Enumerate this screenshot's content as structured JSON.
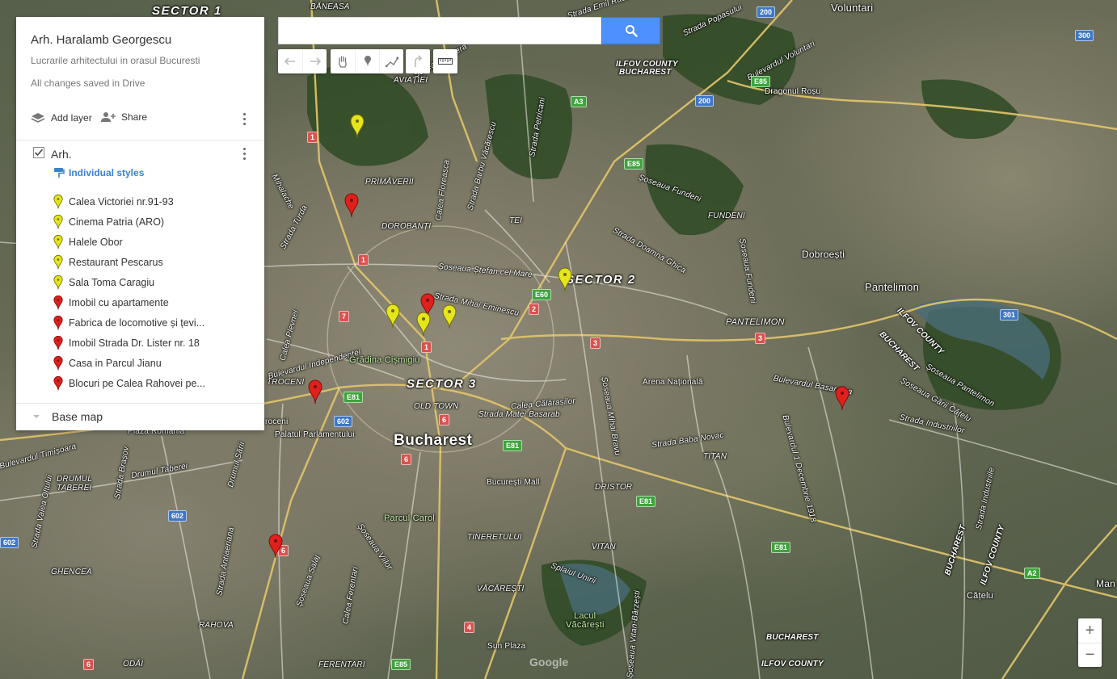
{
  "panel": {
    "title": "Arh. Haralamb Georgescu",
    "description": "Lucrarile arhitectului in orasul Bucuresti",
    "save_status": "All changes saved in Drive",
    "add_layer_label": "Add layer",
    "share_label": "Share",
    "layer": {
      "name": "Arh.",
      "checked": true,
      "styles_label": "Individual styles",
      "features": [
        {
          "label": "Calea Victoriei nr.91-93",
          "color": "#e6e41b"
        },
        {
          "label": "Cinema Patria (ARO)",
          "color": "#e6e41b"
        },
        {
          "label": "Halele Obor",
          "color": "#e6e41b"
        },
        {
          "label": "Restaurant Pescarus",
          "color": "#e6e41b"
        },
        {
          "label": "Sala Toma Caragiu",
          "color": "#e6e41b"
        },
        {
          "label": "Imobil cu apartamente",
          "color": "#e0201c"
        },
        {
          "label": "Fabrica de locomotive și țevi...",
          "color": "#e0201c"
        },
        {
          "label": "Imobil Strada Dr. Lister nr. 18",
          "color": "#e0201c"
        },
        {
          "label": "Casa in Parcul Jianu",
          "color": "#e0201c"
        },
        {
          "label": "Blocuri pe Calea Rahovei pe...",
          "color": "#e0201c"
        }
      ]
    },
    "base_map_label": "Base map"
  },
  "search": {
    "value": "",
    "placeholder": "",
    "button_icon": "search-icon"
  },
  "toolbar": {
    "icons": [
      "undo-icon",
      "redo-icon",
      "hand-icon",
      "marker-icon",
      "draw-line-icon",
      "directions-icon",
      "ruler-icon"
    ]
  },
  "zoom": {
    "in_label": "+",
    "out_label": "−"
  },
  "watermark": "Google",
  "colors": {
    "accent": "#4d90fe",
    "link": "#3b82d4",
    "marker_yellow": "#e6e41b",
    "marker_red": "#e0201c"
  },
  "map": {
    "districts": [
      {
        "key": "sector1",
        "text": "SECTOR 1"
      },
      {
        "key": "sector2",
        "text": "SECTOR 2"
      },
      {
        "key": "sector3",
        "text": "SECTOR 3"
      }
    ],
    "cities": [
      {
        "key": "bucharest",
        "text": "Bucharest"
      }
    ],
    "towns": [
      {
        "key": "voluntari",
        "text": "Voluntari"
      },
      {
        "key": "pantelimon",
        "text": "Pantelimon"
      },
      {
        "key": "dobroesti",
        "text": "Dobroești"
      },
      {
        "key": "catelu",
        "text": "Cățelu"
      },
      {
        "key": "man",
        "text": "Man"
      }
    ],
    "labels": [
      {
        "key": "baneasa",
        "text": "BĂNEASA"
      },
      {
        "key": "aviatiei",
        "text": "AVIAȚIEI"
      },
      {
        "key": "ilfov1",
        "text": "ILFOV COUNTY"
      },
      {
        "key": "bucharest1",
        "text": "BUCHAREST"
      },
      {
        "key": "dragonul",
        "text": "Dragonul Roșu"
      },
      {
        "key": "primaverii",
        "text": "PRIMĂVERII"
      },
      {
        "key": "dorobanti",
        "text": "DOROBANȚI"
      },
      {
        "key": "tei",
        "text": "TEI"
      },
      {
        "key": "fundeni",
        "text": "FUNDENI"
      },
      {
        "key": "pantelimon_d",
        "text": "PANTELIMON"
      },
      {
        "key": "ilfov2",
        "text": "ILFOV COUNTY"
      },
      {
        "key": "bucharest2",
        "text": "BUCHAREST"
      },
      {
        "key": "oldtown",
        "text": "OLD TOWN"
      },
      {
        "key": "drumul_taberei",
        "text": "DRUMUL"
      },
      {
        "key": "taberei",
        "text": "TABEREI"
      },
      {
        "key": "ghencea",
        "text": "GHENCEA"
      },
      {
        "key": "rahova",
        "text": "RAHOVA"
      },
      {
        "key": "ferentari",
        "text": "FERENTARI"
      },
      {
        "key": "odai",
        "text": "ODĂI"
      },
      {
        "key": "tineretului",
        "text": "TINERETULUI"
      },
      {
        "key": "vacaresti",
        "text": "VĂCĂREȘTI"
      },
      {
        "key": "vitan",
        "text": "VITAN"
      },
      {
        "key": "dristor",
        "text": "DRISTOR"
      },
      {
        "key": "titan",
        "text": "TITAN"
      },
      {
        "key": "bucharest3",
        "text": "BUCHAREST"
      },
      {
        "key": "ilfov3",
        "text": "ILFOV COUNTY"
      },
      {
        "key": "bucharest4",
        "text": "BUCHAREST"
      },
      {
        "key": "ilfov4",
        "text": "ILFOV COUNTY"
      },
      {
        "key": "crangasi",
        "text": "TROCENI"
      },
      {
        "key": "croceni",
        "text": "roceni"
      }
    ],
    "streets": [
      {
        "key": "s1",
        "text": "Strada Emil Racoviță"
      },
      {
        "key": "s2",
        "text": "Strada Popasului"
      },
      {
        "key": "s3",
        "text": "Bulevardul Voluntari"
      },
      {
        "key": "s4",
        "text": "Șoseaua Pipera"
      },
      {
        "key": "s5",
        "text": "Strada Petricani"
      },
      {
        "key": "s6",
        "text": "Calea Floreasca"
      },
      {
        "key": "s7",
        "text": "Strada Barbu Văcărescu"
      },
      {
        "key": "s8",
        "text": "Șoseaua Fundeni"
      },
      {
        "key": "s9",
        "text": "Strada Doamna Ghica"
      },
      {
        "key": "s10",
        "text": "Șoseaua Ștefan cel Mare"
      },
      {
        "key": "s11",
        "text": "Strada Mihai Eminescu"
      },
      {
        "key": "s12",
        "text": "Calea Călărașilor"
      },
      {
        "key": "s13",
        "text": "Strada Matei Basarab"
      },
      {
        "key": "s14",
        "text": "Bulevardul Basarabia"
      },
      {
        "key": "s15",
        "text": "Strada Industriilor"
      },
      {
        "key": "s16",
        "text": "Șoseaua Gării Cățelu"
      },
      {
        "key": "s17",
        "text": "Strada Baba Novac"
      },
      {
        "key": "s18",
        "text": "Splaiul Unirii"
      },
      {
        "key": "s19",
        "text": "Calea Plevnei"
      },
      {
        "key": "s20",
        "text": "Șoseaua Mihai Bravu"
      },
      {
        "key": "s21",
        "text": "Bulevardul Timișoara"
      },
      {
        "key": "s22",
        "text": "Drumul Taberei"
      },
      {
        "key": "s23",
        "text": "Strada Valea Oltului"
      },
      {
        "key": "s24",
        "text": "Strada Brașov"
      },
      {
        "key": "s25",
        "text": "Drumul Sării"
      },
      {
        "key": "s26",
        "text": "Strada Antiaeriana"
      },
      {
        "key": "s27",
        "text": "Șoseaua Viilor"
      },
      {
        "key": "s28",
        "text": "Șoseaua Salaj"
      },
      {
        "key": "s29",
        "text": "Calea Ferentari"
      },
      {
        "key": "s30",
        "text": "Șoseaua Vitan-Bârzești"
      },
      {
        "key": "s31",
        "text": "Bulevardul 1 Decembrie 1918"
      },
      {
        "key": "s32",
        "text": "Strada Industriile"
      },
      {
        "key": "s33",
        "text": "Mihalache"
      },
      {
        "key": "s34",
        "text": "Strada Turda"
      },
      {
        "key": "s35",
        "text": "Șoseaua Pantelimon"
      },
      {
        "key": "s36",
        "text": "Bulevardul Independenței"
      },
      {
        "key": "s37",
        "text": "Șoseaua Fundeni"
      }
    ],
    "pois": [
      {
        "key": "cismigiu",
        "text": "Grădina Cișmigiu"
      },
      {
        "key": "arena",
        "text": "Arena Națională"
      },
      {
        "key": "palatul",
        "text": "Palatul Parlamentului"
      },
      {
        "key": "plaza",
        "text": "Plaza România"
      },
      {
        "key": "mall",
        "text": "București Mall"
      },
      {
        "key": "carol",
        "text": "Parcul Carol"
      },
      {
        "key": "sunplaza",
        "text": "Sun Plaza"
      },
      {
        "key": "lacul",
        "text": "Lacul"
      },
      {
        "key": "lacul2",
        "text": "Văcărești"
      }
    ],
    "shields": [
      {
        "key": "r200a",
        "text": "200",
        "kind": "blue"
      },
      {
        "key": "r300",
        "text": "300",
        "kind": "blue"
      },
      {
        "key": "r200b",
        "text": "200",
        "kind": "blue"
      },
      {
        "key": "rE85a",
        "text": "E85",
        "kind": "green"
      },
      {
        "key": "rA3",
        "text": "A3",
        "kind": "green"
      },
      {
        "key": "rE85b",
        "text": "E85",
        "kind": "green"
      },
      {
        "key": "r1a",
        "text": "1",
        "kind": "red"
      },
      {
        "key": "r1b",
        "text": "1",
        "kind": "red"
      },
      {
        "key": "r7",
        "text": "7",
        "kind": "red"
      },
      {
        "key": "r1c",
        "text": "1",
        "kind": "red"
      },
      {
        "key": "r2",
        "text": "2",
        "kind": "red"
      },
      {
        "key": "rE60",
        "text": "E60",
        "kind": "green"
      },
      {
        "key": "r3a",
        "text": "3",
        "kind": "red"
      },
      {
        "key": "r3b",
        "text": "3",
        "kind": "red"
      },
      {
        "key": "r301",
        "text": "301",
        "kind": "blue"
      },
      {
        "key": "rE81a",
        "text": "E81",
        "kind": "green"
      },
      {
        "key": "r602a",
        "text": "602",
        "kind": "blue"
      },
      {
        "key": "r6a",
        "text": "6",
        "kind": "red"
      },
      {
        "key": "rE81b",
        "text": "E81",
        "kind": "green"
      },
      {
        "key": "r6b",
        "text": "6",
        "kind": "red"
      },
      {
        "key": "r602b",
        "text": "602",
        "kind": "blue"
      },
      {
        "key": "r602c",
        "text": "602",
        "kind": "blue"
      },
      {
        "key": "r6c",
        "text": "6",
        "kind": "red"
      },
      {
        "key": "rE81c",
        "text": "E81",
        "kind": "green"
      },
      {
        "key": "rE81d",
        "text": "E81",
        "kind": "green"
      },
      {
        "key": "r4",
        "text": "4",
        "kind": "red"
      },
      {
        "key": "rE85c",
        "text": "E85",
        "kind": "green"
      },
      {
        "key": "r6d",
        "text": "6",
        "kind": "red"
      },
      {
        "key": "rA2",
        "text": "A2",
        "kind": "green"
      }
    ]
  }
}
